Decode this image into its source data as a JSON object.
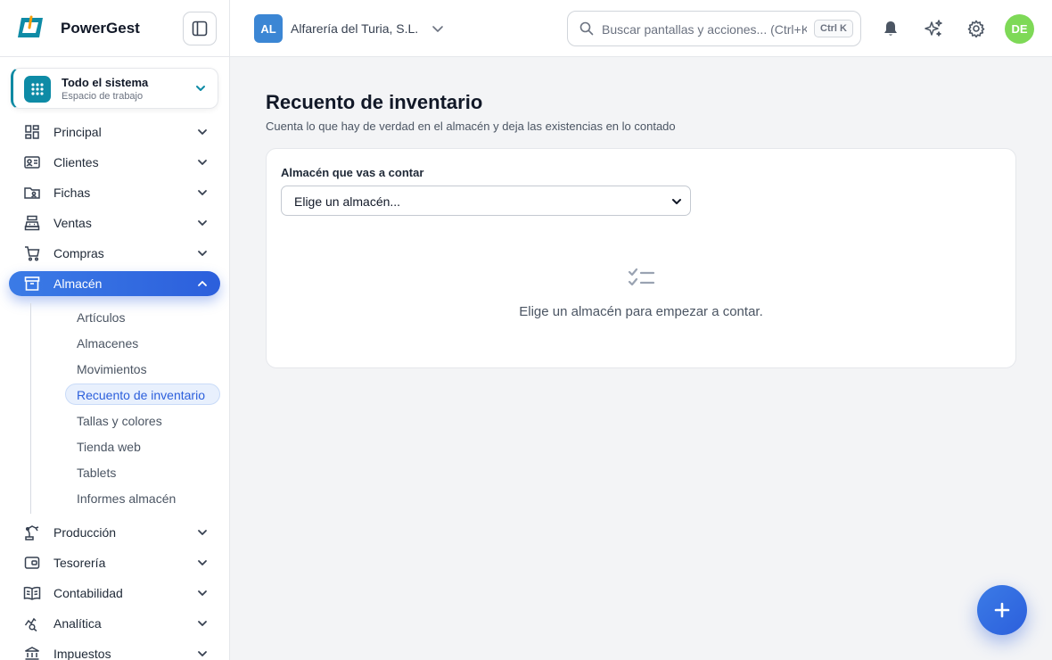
{
  "app": {
    "name": "PowerGest"
  },
  "workspace": {
    "title": "Todo el sistema",
    "subtitle": "Espacio de trabajo"
  },
  "sidebar": {
    "items": [
      {
        "label": "Principal",
        "icon": "dashboard-icon"
      },
      {
        "label": "Clientes",
        "icon": "contact-card-icon"
      },
      {
        "label": "Fichas",
        "icon": "folder-user-icon"
      },
      {
        "label": "Ventas",
        "icon": "cash-register-icon"
      },
      {
        "label": "Compras",
        "icon": "cart-icon"
      },
      {
        "label": "Almacén",
        "icon": "archive-box-icon",
        "active": true
      },
      {
        "label": "Producción",
        "icon": "robot-arm-icon"
      },
      {
        "label": "Tesorería",
        "icon": "wallet-icon"
      },
      {
        "label": "Contabilidad",
        "icon": "book-icon"
      },
      {
        "label": "Analítica",
        "icon": "analytics-icon"
      },
      {
        "label": "Impuestos",
        "icon": "bank-icon"
      }
    ],
    "subitems": [
      {
        "label": "Artículos"
      },
      {
        "label": "Almacenes"
      },
      {
        "label": "Movimientos"
      },
      {
        "label": "Recuento de inventario",
        "active": true
      },
      {
        "label": "Tallas y colores"
      },
      {
        "label": "Tienda web"
      },
      {
        "label": "Tablets"
      },
      {
        "label": "Informes almacén"
      }
    ]
  },
  "header": {
    "company_initials": "AL",
    "company_name": "Alfarería del Turia, S.L.",
    "search_placeholder": "Buscar pantallas y acciones... (Ctrl+K)",
    "search_shortcut": "Ctrl K",
    "user_initials": "DE"
  },
  "main": {
    "title": "Recuento de inventario",
    "subtitle": "Cuenta lo que hay de verdad en el almacén y deja las existencias en lo contado",
    "warehouse_label": "Almacén que vas a contar",
    "warehouse_select_value": "Elige un almacén...",
    "empty_message": "Elige un almacén para empezar a contar."
  },
  "colors": {
    "accent": "#2c5fdc",
    "brand_teal": "#0e8ba6",
    "company_avatar": "#3b86d4",
    "user_avatar": "#7ed957"
  }
}
